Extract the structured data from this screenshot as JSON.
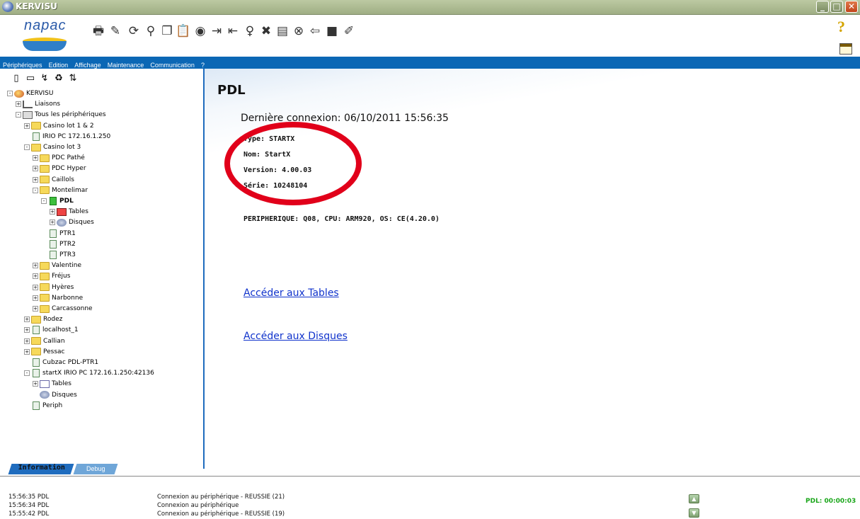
{
  "window": {
    "title": "KERVISU"
  },
  "logo": {
    "text": "napac"
  },
  "toolbar": {
    "icons": [
      "printer-icon",
      "edit-icon",
      "refresh-icon",
      "binoculars-icon",
      "copy-icon",
      "paste-icon",
      "globe-icon",
      "export-icon",
      "import-icon",
      "bulb-icon",
      "stop-icon",
      "notes-icon",
      "close-circle-icon",
      "back-arrow-icon",
      "terminal-icon",
      "tools-icon"
    ]
  },
  "menu": [
    "Périphériques",
    "Edition",
    "Affichage",
    "Maintenance",
    "Communication",
    "?"
  ],
  "tree": [
    {
      "label": "KERVISU",
      "level": 0,
      "exp": "-",
      "icon": "world"
    },
    {
      "label": "Liaisons",
      "level": 1,
      "exp": "+",
      "icon": "link"
    },
    {
      "label": "Tous les périphériques",
      "level": 1,
      "exp": "-",
      "icon": "list"
    },
    {
      "label": "Casino lot 1 & 2",
      "level": 2,
      "exp": "+",
      "icon": "folder"
    },
    {
      "label": "IRIO PC 172.16.1.250",
      "level": 2,
      "exp": "",
      "icon": "device"
    },
    {
      "label": "Casino lot 3",
      "level": 2,
      "exp": "-",
      "icon": "folder"
    },
    {
      "label": "PDC Pathé",
      "level": 3,
      "exp": "+",
      "icon": "folder"
    },
    {
      "label": "PDC Hyper",
      "level": 3,
      "exp": "+",
      "icon": "folder"
    },
    {
      "label": "Caillols",
      "level": 3,
      "exp": "+",
      "icon": "folder"
    },
    {
      "label": "Montelimar",
      "level": 3,
      "exp": "-",
      "icon": "folder"
    },
    {
      "label": "PDL",
      "level": 4,
      "exp": "-",
      "icon": "devgreen",
      "bold": true
    },
    {
      "label": "Tables",
      "level": 5,
      "exp": "+",
      "icon": "tablered"
    },
    {
      "label": "Disques",
      "level": 5,
      "exp": "+",
      "icon": "disk"
    },
    {
      "label": "PTR1",
      "level": 4,
      "exp": "",
      "icon": "device"
    },
    {
      "label": "PTR2",
      "level": 4,
      "exp": "",
      "icon": "device"
    },
    {
      "label": "PTR3",
      "level": 4,
      "exp": "",
      "icon": "device"
    },
    {
      "label": "Valentine",
      "level": 3,
      "exp": "+",
      "icon": "folder"
    },
    {
      "label": "Fréjus",
      "level": 3,
      "exp": "+",
      "icon": "folder"
    },
    {
      "label": "Hyères",
      "level": 3,
      "exp": "+",
      "icon": "folder"
    },
    {
      "label": "Narbonne",
      "level": 3,
      "exp": "+",
      "icon": "folder"
    },
    {
      "label": "Carcassonne",
      "level": 3,
      "exp": "+",
      "icon": "folder"
    },
    {
      "label": "Rodez",
      "level": 2,
      "exp": "+",
      "icon": "folder"
    },
    {
      "label": "localhost_1",
      "level": 2,
      "exp": "+",
      "icon": "device"
    },
    {
      "label": "Callian",
      "level": 2,
      "exp": "+",
      "icon": "folder"
    },
    {
      "label": "Pessac",
      "level": 2,
      "exp": "+",
      "icon": "folder"
    },
    {
      "label": "Cubzac PDL-PTR1",
      "level": 2,
      "exp": "",
      "icon": "device"
    },
    {
      "label": "startX IRIO PC 172.16.1.250:42136",
      "level": 2,
      "exp": "-",
      "icon": "device"
    },
    {
      "label": "Tables",
      "level": 3,
      "exp": "+",
      "icon": "table"
    },
    {
      "label": "Disques",
      "level": 3,
      "exp": "",
      "icon": "disk"
    },
    {
      "label": "Periph",
      "level": 2,
      "exp": "",
      "icon": "device"
    }
  ],
  "tabs": {
    "information": "Information",
    "debug": "Debug"
  },
  "main": {
    "title": "PDL",
    "last_connection": "Dernière connexion: 06/10/2011 15:56:35",
    "type": "Type: STARTX",
    "nom": "Nom: StartX",
    "version": "Version: 4.00.03",
    "serie": "Série: 10248104",
    "peripherique": "PERIPHERIQUE: Q08, CPU: ARM920, OS: CE(4.20.0)",
    "link_tables": "Accéder aux Tables",
    "link_disques": "Accéder aux Disques"
  },
  "log": [
    {
      "time": "15:56:35 PDL",
      "msg": "Connexion au périphérique - REUSSIE (21)"
    },
    {
      "time": "15:56:34 PDL",
      "msg": "Connexion au périphérique"
    },
    {
      "time": "15:55:42 PDL",
      "msg": "Connexion au périphérique - REUSSIE (19)"
    }
  ],
  "status_timer": "PDL: 00:00:03",
  "colors": {
    "menubar": "#0b67b5",
    "annotation_circle": "#e1001a",
    "timer": "#1aa61a"
  }
}
